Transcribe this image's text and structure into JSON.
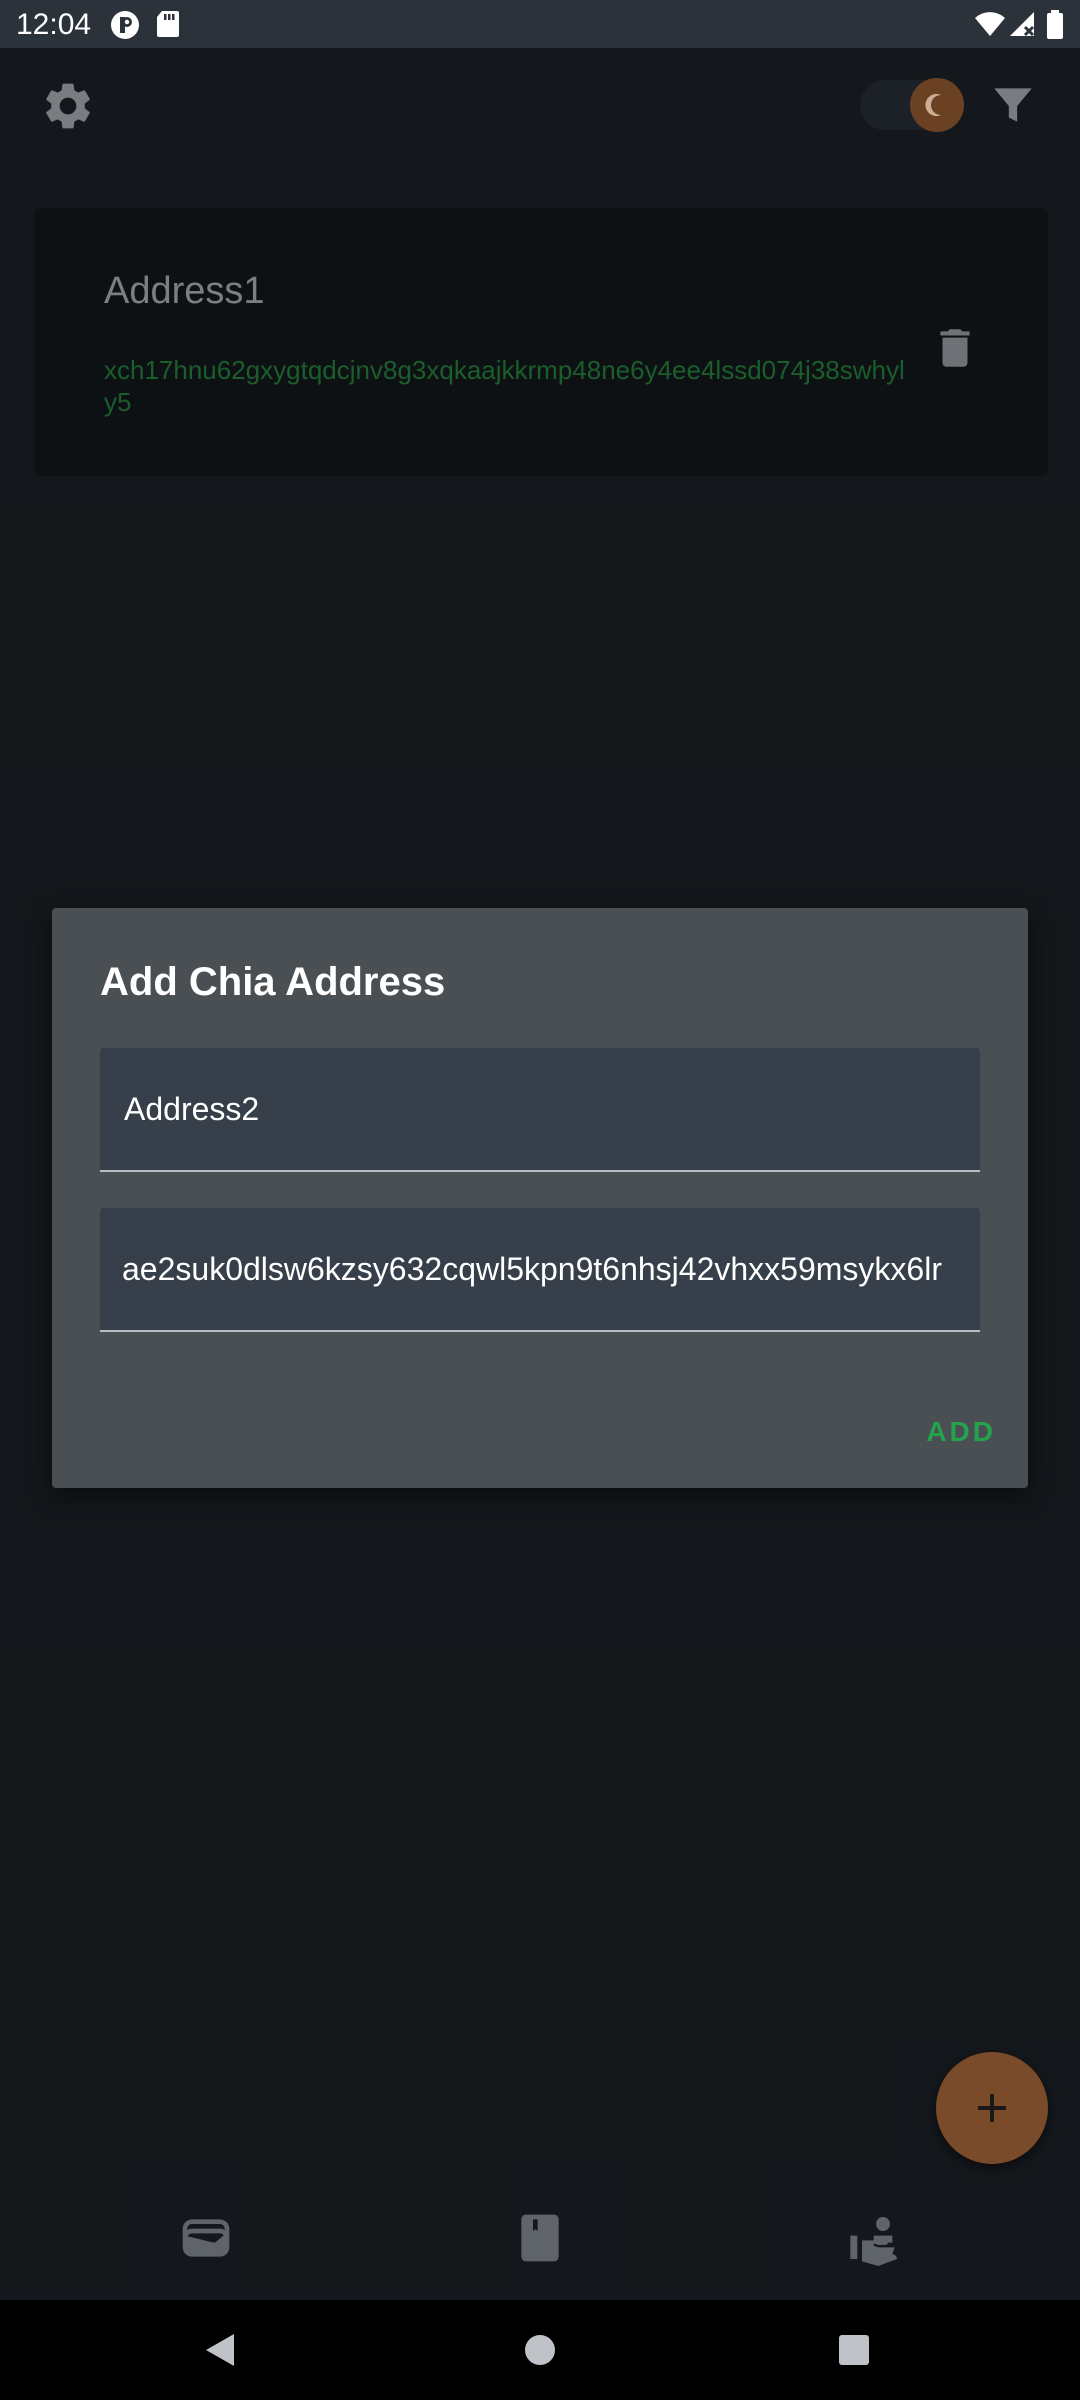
{
  "status_bar": {
    "time": "12:04",
    "icons": [
      "app-notification-icon",
      "sd-card-icon",
      "wifi-icon",
      "cell-signal-icon",
      "battery-icon"
    ]
  },
  "top_bar": {
    "left_icon": "gear-icon",
    "theme_toggle_icon": "moon-icon",
    "right_icon": "filter-icon"
  },
  "address_list": [
    {
      "name": "Address1",
      "address": "xch17hnu62gxygtqdcjnv8g3xqkaajkkrmp48ne6y4ee4lssd074j38swhyly5",
      "delete_icon": "trash-icon"
    }
  ],
  "dialog": {
    "title": "Add Chia Address",
    "name_field_value": "Address2",
    "address_field_value": "ae2suk0dlsw6kzsy632cqwl5kpn9t6nhsj42vhxx59msykx6lr",
    "add_label": "ADD"
  },
  "fab": {
    "icon": "plus-icon"
  },
  "bottom_nav": [
    {
      "icon": "wallet-icon"
    },
    {
      "icon": "bookmark-icon"
    },
    {
      "icon": "hand-person-icon"
    }
  ],
  "system_nav": [
    "back-icon",
    "home-icon",
    "recents-icon"
  ],
  "colors": {
    "background": "#171b1f",
    "accent_green": "#23a44b",
    "fab": "#7a4b2a",
    "dialog": "#4a4f54"
  }
}
